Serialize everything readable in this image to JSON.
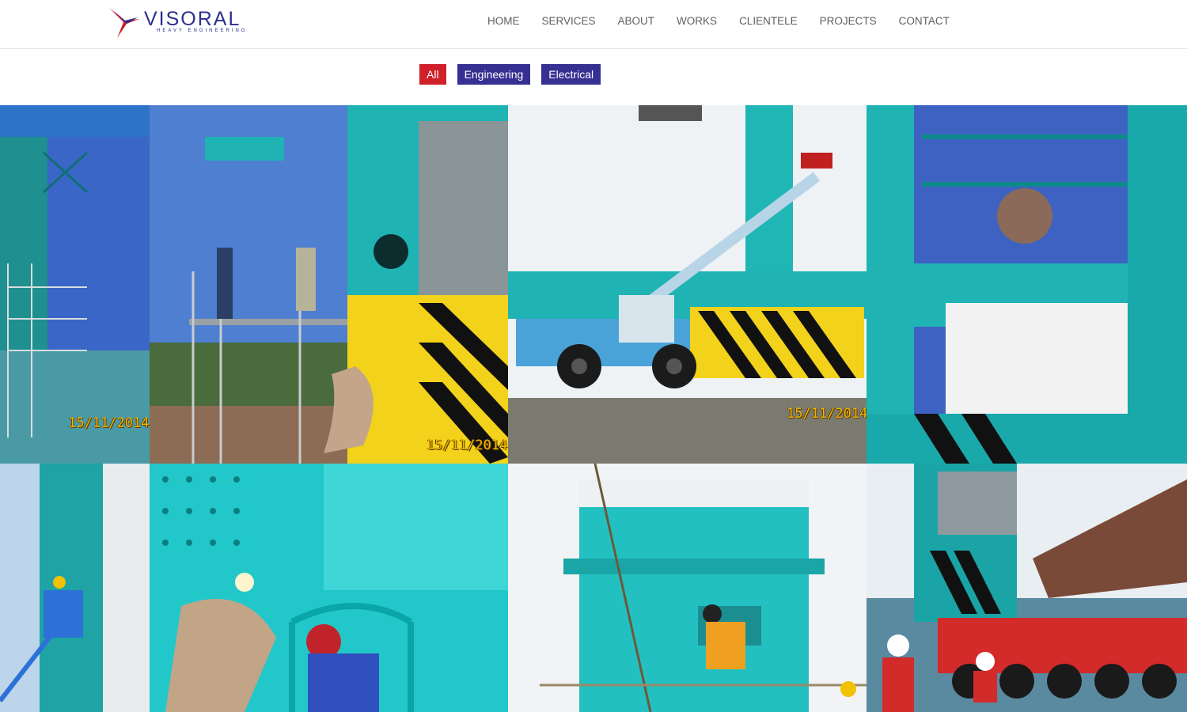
{
  "brand": {
    "name": "VISORAL",
    "tagline": "HEAVY ENGINEERING",
    "colors": {
      "navy": "#2a2f8f",
      "red": "#d0202a"
    }
  },
  "nav": {
    "items": [
      {
        "label": "HOME"
      },
      {
        "label": "SERVICES"
      },
      {
        "label": "ABOUT"
      },
      {
        "label": "WORKS"
      },
      {
        "label": "CLIENTELE"
      },
      {
        "label": "PROJECTS"
      },
      {
        "label": "CONTACT"
      }
    ]
  },
  "filters": {
    "items": [
      {
        "label": "All",
        "active": true,
        "color": "#d0202a"
      },
      {
        "label": "Engineering",
        "active": false,
        "color": "#353092"
      },
      {
        "label": "Electrical",
        "active": false,
        "color": "#353092"
      }
    ]
  },
  "gallery": {
    "tiles": [
      {
        "id": "tile-1",
        "stamp": "15/11/2014"
      },
      {
        "id": "tile-2",
        "stamp": "15/11/2014"
      },
      {
        "id": "tile-3",
        "stamp": "15/11/2014"
      },
      {
        "id": "tile-4",
        "stamp": ""
      },
      {
        "id": "tile-5",
        "stamp": ""
      },
      {
        "id": "tile-6",
        "stamp": ""
      },
      {
        "id": "tile-7",
        "stamp": ""
      },
      {
        "id": "tile-8",
        "stamp": ""
      }
    ]
  }
}
